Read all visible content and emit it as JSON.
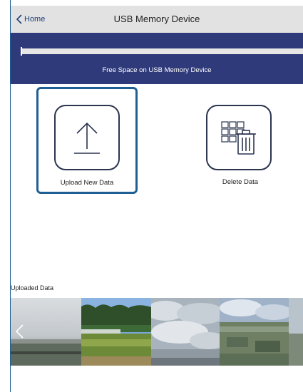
{
  "header": {
    "back_label": "Home",
    "title": "USB Memory Device"
  },
  "storage": {
    "free_space_label": "Free Space on USB Memory Device",
    "used_fraction": 0.005
  },
  "actions": [
    {
      "label": "Upload New Data",
      "icon": "upload-arrow-icon",
      "selected": true
    },
    {
      "label": "Delete Data",
      "icon": "grid-trash-icon",
      "selected": false
    }
  ],
  "gallery": {
    "label": "Uploaded Data"
  },
  "colors": {
    "band": "#2f3a7a",
    "selection": "#1f5f93",
    "header": "#e2e2e2"
  }
}
